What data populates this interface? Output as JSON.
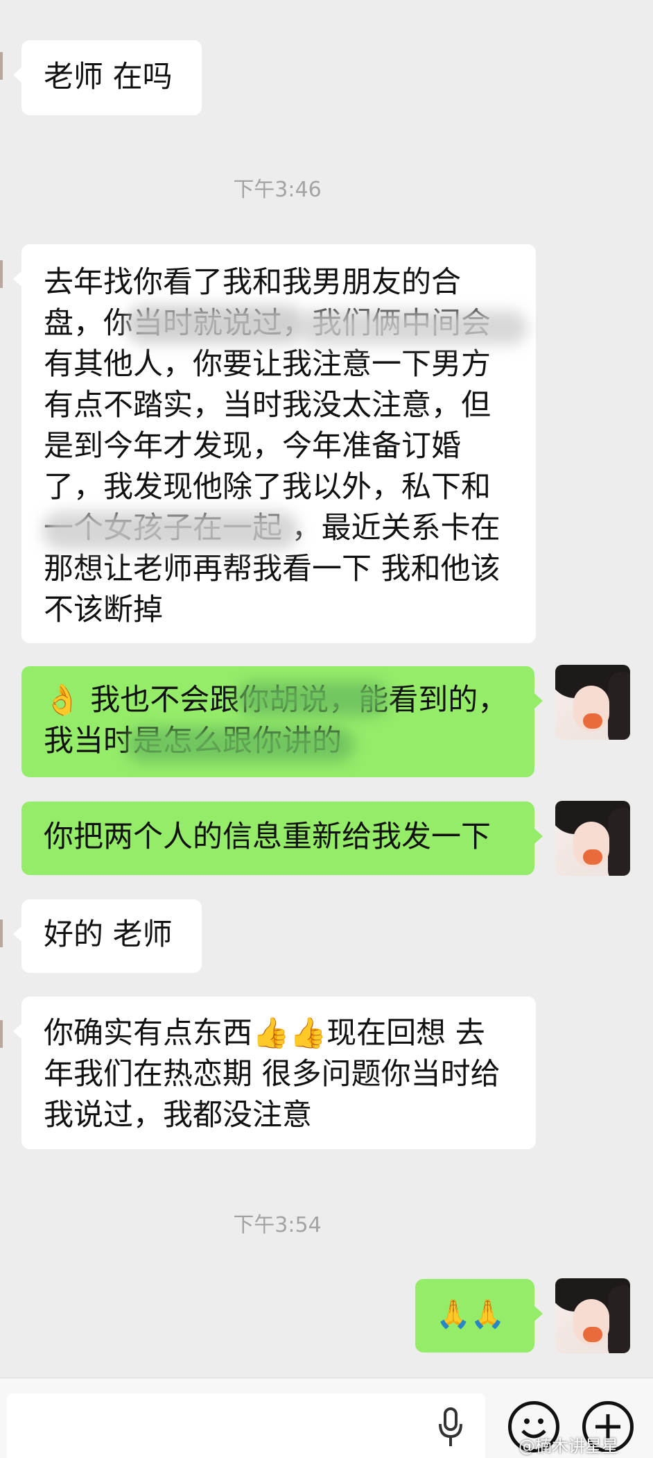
{
  "messages": {
    "m1": "老师 在吗",
    "t1": "下午3:46",
    "m2": "去年找你看了我和我男朋友的合盘，你当时就说过，我们俩中间会有其他人，你要让我注意一下男方有点不踏实，当时我没太注意，但是到今年才发现，今年准备订婚了，我发现他除了我以外，私下和一个女孩子在一起 ，最近关系卡在那想让老师再帮我看一下 我和他该不该断掉",
    "m3_text": "我也不会跟你胡说，能看到的，我当时是怎么跟你讲的",
    "m3_emoji": "👌",
    "m4": "你把两个人的信息重新给我发一下",
    "m5": "好的 老师",
    "m6_a": "你确实有点东西",
    "m6_emoji": "👍👍",
    "m6_b": "现在回想 去年我们在热恋期 很多问题你当时给我说过，我都没注意",
    "t2": "下午3:54",
    "m7": "🙏🙏"
  },
  "input_bar": {
    "mic_icon": "microphone",
    "emoji_icon": "smiley",
    "plus_icon": "plus"
  },
  "watermark": "@楠木讲星星",
  "colors": {
    "background": "#ededed",
    "incoming_bubble": "#ffffff",
    "outgoing_bubble": "#95ec69"
  }
}
